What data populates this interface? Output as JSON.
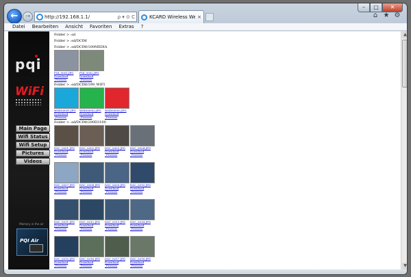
{
  "browser": {
    "address": "http://192.168.1.1/",
    "addr_tools": "ρ ▾ ⊙ C",
    "tab_title": "KCARD Wireless Webpages",
    "tab_close": "×",
    "back": "←",
    "forward": "→",
    "window_controls": {
      "min": "–",
      "max": "□",
      "close": "✕"
    },
    "right_icons": {
      "home": "⌂",
      "star": "★",
      "gear": "⚙"
    },
    "menu": [
      "Datei",
      "Bearbeiten",
      "Ansicht",
      "Favoriten",
      "Extras",
      "?"
    ]
  },
  "sidebar": {
    "brand": "pqi",
    "wifi": "WiFi",
    "nav": [
      "Main Page",
      "Wifi Status",
      "Wifi Setup",
      "Pictures",
      "Videos"
    ],
    "tagline": "Memory in the air",
    "product": "PQI Air"
  },
  "content": {
    "lines": {
      "sd": "Folder > :sd",
      "dcim": "Folder > :sd/DCIM",
      "media": "Folder > :sd/DCIM/100MEDIA",
      "wifi": "Folder > :sd/DCIM/199_WIFI",
      "d100": "Folder > :sd/DCIM/200D3100"
    },
    "media_files": [
      {
        "name": "PQI_0001.JPG",
        "color": "#8b93a0"
      },
      {
        "name": "PQI_0002.JPG",
        "color": "#7d8a7a"
      }
    ],
    "wifi_files": [
      {
        "name": "WSD00001.JPG",
        "color": "#1aa7d9"
      },
      {
        "name": "WSD00002.JPG",
        "color": "#25b34b"
      },
      {
        "name": "WSD00003.JPG",
        "color": "#e2262e"
      }
    ],
    "d3100_rows": [
      [
        {
          "name": "DSC_0001.JPG",
          "color": "#5a5046"
        },
        {
          "name": "DSC_0002.JPG",
          "color": "#6b5e55"
        },
        {
          "name": "DSC_0003.JPG",
          "color": "#4f4a45"
        },
        {
          "name": "DSC_0004.JPG",
          "color": "#6a7078"
        }
      ],
      [
        {
          "name": "DSC_0007.JPG",
          "color": "#8ca6c4"
        },
        {
          "name": "DSC_0008.JPG",
          "color": "#3f5a78"
        },
        {
          "name": "DSC_0009.JPG",
          "color": "#4a6585"
        },
        {
          "name": "DSC_0010.JPG",
          "color": "#2f4a6a"
        }
      ],
      [
        {
          "name": "DSC_0011.JPG",
          "color": "#35506f"
        },
        {
          "name": "DSC_0012.JPG",
          "color": "#2c4763"
        },
        {
          "name": "DSC_0013.JPG",
          "color": "#3d5977"
        },
        {
          "name": "DSC_0014.JPG",
          "color": "#4d6986"
        }
      ],
      [
        {
          "name": "DSC_0015.JPG",
          "color": "#25405e"
        },
        {
          "name": "DSC_0016.JPG",
          "color": "#5b6f5a"
        },
        {
          "name": "DSC_0017.JPG",
          "color": "#4f5e4c"
        },
        {
          "name": "DSC_0018.JPG",
          "color": "#6a7868"
        }
      ]
    ],
    "download_label": "Download",
    "preview_label": "_Preview"
  }
}
